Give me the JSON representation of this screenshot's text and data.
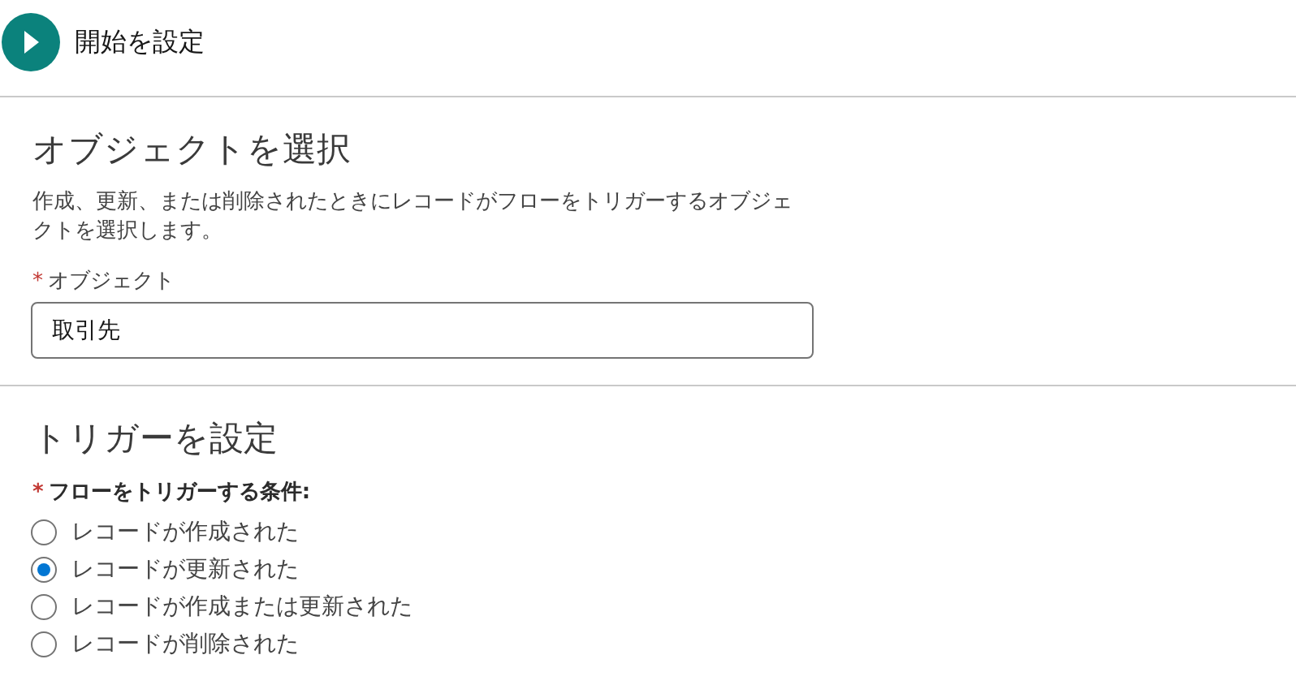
{
  "header": {
    "title": "開始を設定"
  },
  "object_section": {
    "heading": "オブジェクトを選択",
    "description": "作成、更新、または削除されたときにレコードがフローをトリガーするオブジェクトを選択します。",
    "field": {
      "required_mark": "*",
      "label": "オブジェクト",
      "value": "取引先"
    }
  },
  "trigger_section": {
    "heading": "トリガーを設定",
    "group": {
      "required_mark": "*",
      "label": "フローをトリガーする条件:"
    },
    "options": [
      {
        "label": "レコードが作成された",
        "selected": false
      },
      {
        "label": "レコードが更新された",
        "selected": true
      },
      {
        "label": "レコードが作成または更新された",
        "selected": false
      },
      {
        "label": "レコードが削除された",
        "selected": false
      }
    ]
  }
}
